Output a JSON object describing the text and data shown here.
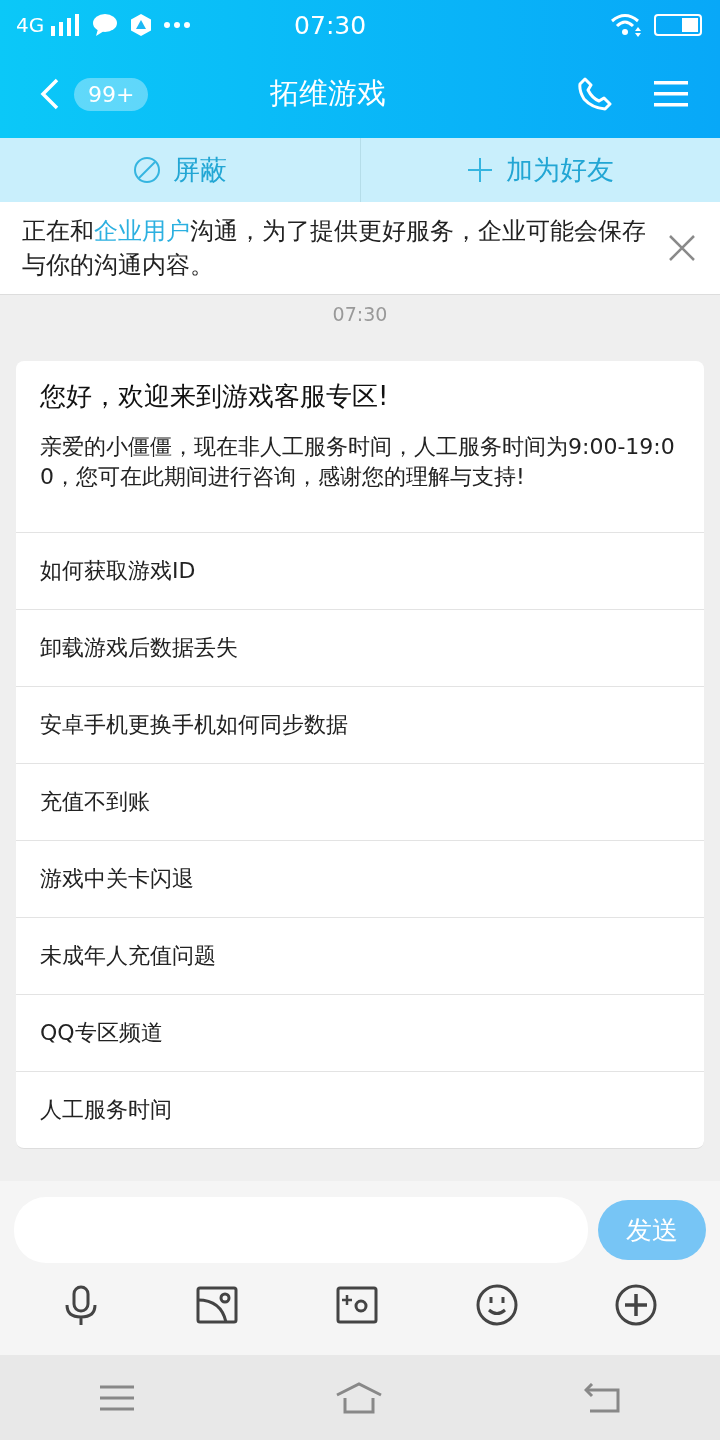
{
  "status_bar": {
    "network": "4G",
    "time": "07:30"
  },
  "header": {
    "title": "拓维游戏",
    "unread_badge": "99+"
  },
  "actions": [
    {
      "kind": "block",
      "label": "屏蔽"
    },
    {
      "kind": "add",
      "label": "加为好友"
    }
  ],
  "notice": {
    "text_before": "正在和",
    "link": "企业用户",
    "text_after": "沟通，为了提供更好服务，企业可能会保存与你的沟通内容。"
  },
  "timestamp": "07:30",
  "message": {
    "title": "您好，欢迎来到游戏客服专区!",
    "body": "亲爱的小僵僵，现在非人工服务时间，人工服务时间为9:00-19:00，您可在此期间进行咨询，感谢您的理解与支持!",
    "options": [
      "如何获取游戏ID",
      "卸载游戏后数据丢失",
      "安卓手机更换手机如何同步数据",
      "充值不到账",
      "游戏中关卡闪退",
      "未成年人充值问题",
      "QQ专区频道",
      "人工服务时间"
    ]
  },
  "composer": {
    "send": "发送"
  }
}
